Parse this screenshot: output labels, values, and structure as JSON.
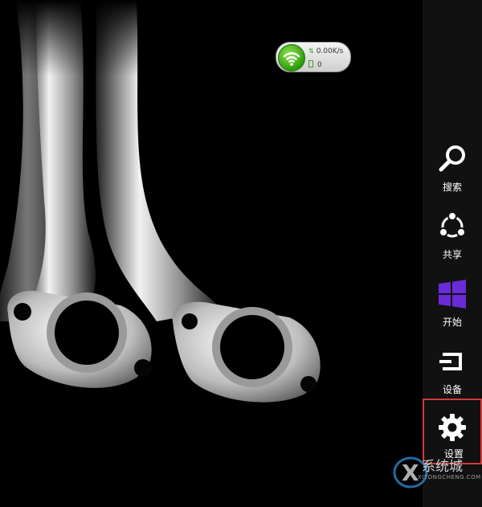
{
  "desktop": {
    "wallpaper_subject": "photograph"
  },
  "network_widget": {
    "speed": "0.00K/s",
    "count": "0",
    "status_color": "#3aa21a",
    "icon": "wifi-icon"
  },
  "charms": {
    "items": [
      {
        "label": "搜索",
        "icon": "search-icon"
      },
      {
        "label": "共享",
        "icon": "share-icon"
      },
      {
        "label": "开始",
        "icon": "windows-logo-icon"
      },
      {
        "label": "设备",
        "icon": "devices-icon"
      },
      {
        "label": "设置",
        "icon": "gear-icon",
        "selected": true
      }
    ],
    "highlight_color": "#d23a3a",
    "start_color": "#6a2bd6"
  },
  "watermark": {
    "text": "系统城",
    "subtext": "XITONGCHENG.COM"
  }
}
